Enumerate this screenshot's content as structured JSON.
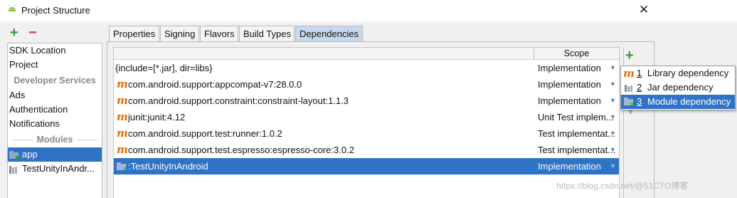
{
  "window": {
    "title": "Project Structure",
    "close_glyph": "✕",
    "app_icon": "android-icon"
  },
  "left_toolbar": {
    "add": "+",
    "remove": "−"
  },
  "sidebar": {
    "items": [
      {
        "label": "SDK Location"
      },
      {
        "label": "Project"
      },
      {
        "label": "Developer Services",
        "type": "header"
      },
      {
        "label": "Ads"
      },
      {
        "label": "Authentication"
      },
      {
        "label": "Notifications"
      },
      {
        "label": "Modules",
        "type": "header"
      },
      {
        "label": "app",
        "selected": true,
        "icon": "module-icon"
      },
      {
        "label": "TestUnityInAndr...",
        "icon": "library-module-icon"
      }
    ]
  },
  "tabs": [
    {
      "label": "Properties"
    },
    {
      "label": "Signing"
    },
    {
      "label": "Flavors"
    },
    {
      "label": "Build Types"
    },
    {
      "label": "Dependencies",
      "active": true
    }
  ],
  "table": {
    "columns": [
      "",
      "Scope"
    ],
    "rows": [
      {
        "name": "{include=[*.jar], dir=libs}",
        "scope": "Implementation",
        "icon": ""
      },
      {
        "name": "com.android.support:appcompat-v7:28.0.0",
        "scope": "Implementation",
        "icon": "maven-icon"
      },
      {
        "name": "com.android.support.constraint:constraint-layout:1.1.3",
        "scope": "Implementation",
        "icon": "maven-icon"
      },
      {
        "name": "junit:junit:4.12",
        "scope": "Unit Test implem...",
        "icon": "maven-icon"
      },
      {
        "name": "com.android.support.test:runner:1.0.2",
        "scope": "Test implementat...",
        "icon": "maven-icon"
      },
      {
        "name": "com.android.support.test.espresso:espresso-core:3.0.2",
        "scope": "Test implementat...",
        "icon": "maven-icon"
      },
      {
        "name": ":TestUnityInAndroid",
        "scope": "Implementation",
        "icon": "module-icon",
        "selected": true
      }
    ],
    "dropdown_glyph": "▼",
    "maven_glyph": "m"
  },
  "right_toolbar": {
    "add": "+",
    "up": "▲",
    "down": "▼"
  },
  "add_menu": {
    "items": [
      {
        "num": "1",
        "label": "Library dependency",
        "icon": "maven-icon"
      },
      {
        "num": "2",
        "label": "Jar dependency",
        "icon": "jar-icon"
      },
      {
        "num": "3",
        "label": "Module dependency",
        "icon": "module-icon",
        "active": true
      }
    ]
  },
  "watermark": "https://blog.csdn.net/@51CTO博客",
  "colors": {
    "selection": "#2f73c6",
    "tab_active": "#c8d8ec",
    "maven": "#e36c09",
    "add": "#3a9a3a",
    "remove": "#d23a3a"
  }
}
